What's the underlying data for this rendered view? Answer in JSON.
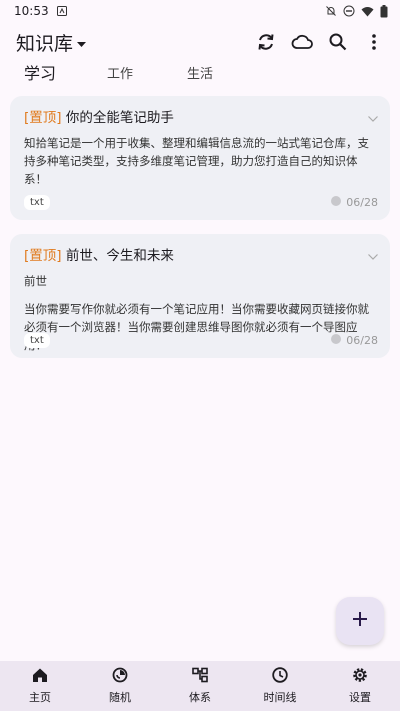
{
  "status_bar": {
    "time": "10:53"
  },
  "header": {
    "title": "知识库",
    "icons": [
      "sync-icon",
      "cloud-icon",
      "search-icon",
      "more-vert-icon"
    ]
  },
  "tabs": [
    {
      "label": "学习",
      "active": true
    },
    {
      "label": "工作",
      "active": false
    },
    {
      "label": "生活",
      "active": false
    }
  ],
  "notes": [
    {
      "pin": "[置顶]",
      "title": "你的全能笔记助手",
      "body": "知拾笔记是一个用于收集、整理和编辑信息流的一站式笔记仓库，支持多种笔记类型，支持多维度笔记管理，助力您打造自己的知识体系！",
      "tag": "txt",
      "date": "06/28"
    },
    {
      "pin": "[置顶]",
      "title": "前世、今生和未来",
      "body_line1": "前世",
      "body": "当你需要写作你就必须有一个笔记应用！当你需要收藏网页链接你就必须有一个浏览器！当你需要创建思维导图你就必须有一个导图应用！",
      "tag": "txt",
      "date": "06/28"
    }
  ],
  "fab": {
    "icon": "plus-icon"
  },
  "bottom_nav": [
    {
      "label": "主页",
      "icon": "home-icon"
    },
    {
      "label": "随机",
      "icon": "random-icon"
    },
    {
      "label": "体系",
      "icon": "hierarchy-icon"
    },
    {
      "label": "时间线",
      "icon": "clock-icon"
    },
    {
      "label": "设置",
      "icon": "settings-icon"
    }
  ],
  "colors": {
    "pin": "#e07b1f",
    "card_bg": "#eff0f5",
    "nav_bg": "#ede6f1",
    "fab_bg": "#e9e3f3"
  }
}
